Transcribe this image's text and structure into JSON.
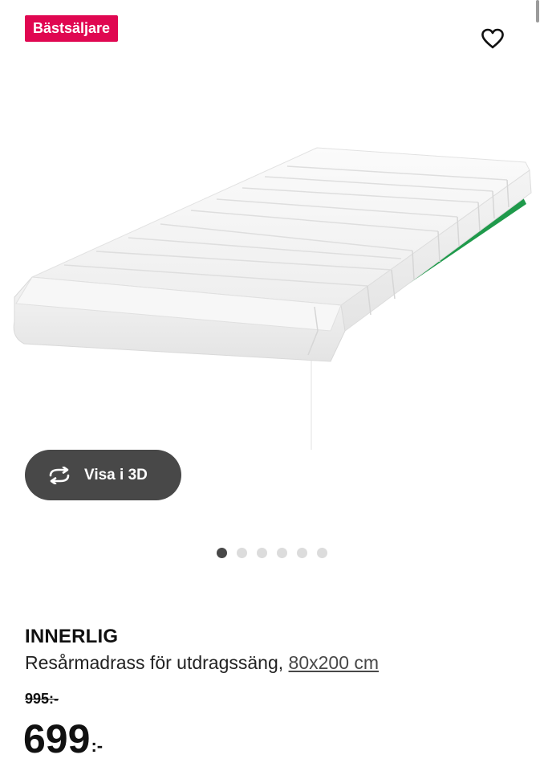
{
  "badge": {
    "label": "Bästsäljare",
    "color": "#e00751"
  },
  "favorite": {
    "icon": "heart-icon"
  },
  "product_image": {
    "subject": "mattress"
  },
  "view3d": {
    "label": "Visa i 3D",
    "icon": "rotate-3d-icon"
  },
  "carousel": {
    "count": 6,
    "active_index": 0
  },
  "product": {
    "name": "INNERLIG",
    "description": "Resårmadrass för utdragssäng,",
    "size_label": "80x200 cm"
  },
  "pricing": {
    "old_price": "995:-",
    "price_main": "699",
    "price_suffix": ":-"
  }
}
